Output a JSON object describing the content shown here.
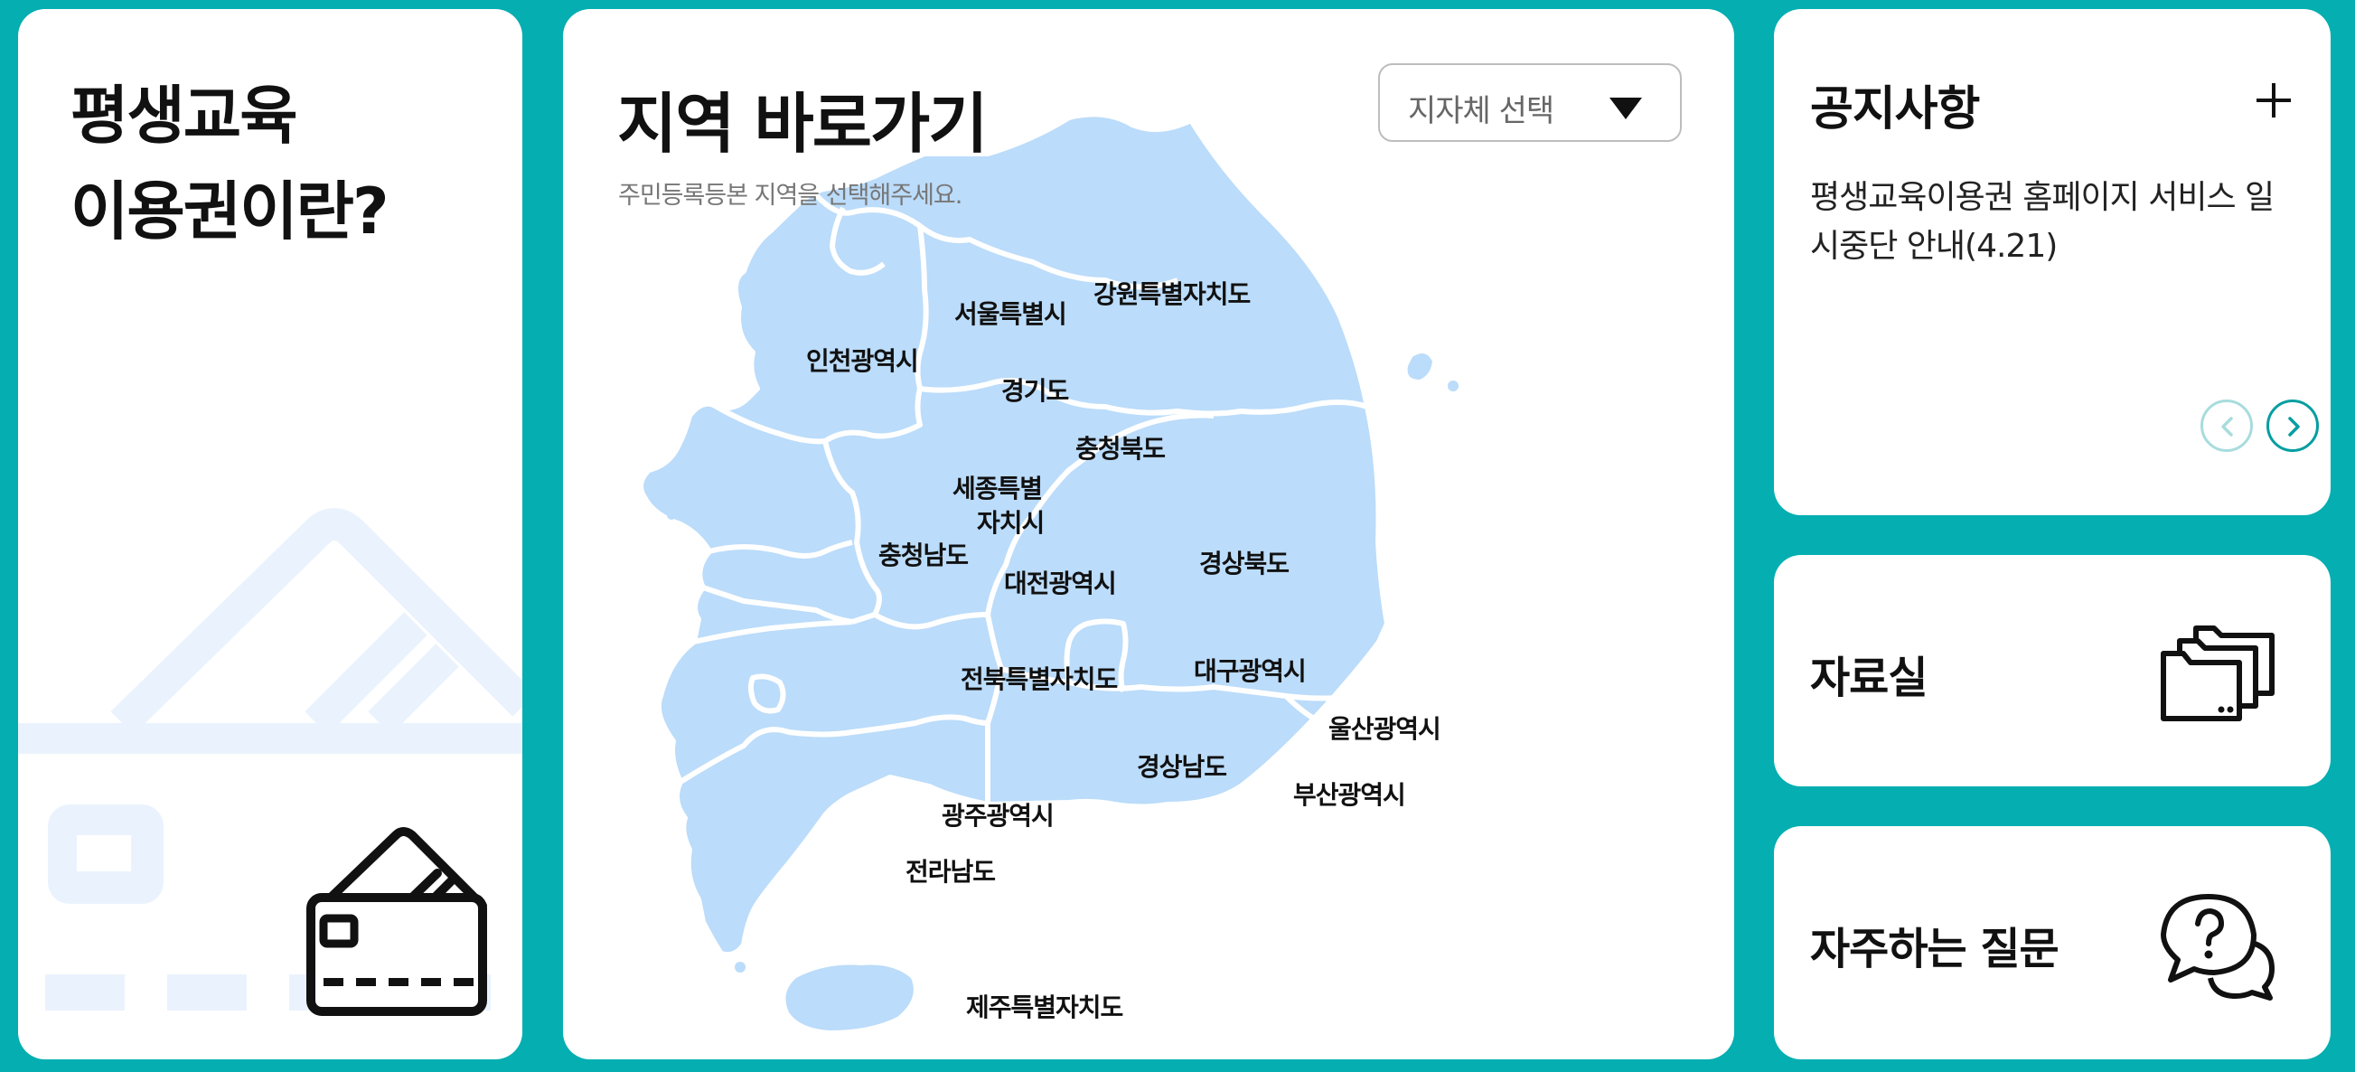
{
  "voucher_panel": {
    "title_line1": "평생교육",
    "title_line2": "이용권이란?",
    "icon": "credit-card-icon"
  },
  "region_map": {
    "title": "지역 바로가기",
    "subtitle": "주민등록등본 지역을 선택해주세요.",
    "select_label": "지자체 선택",
    "regions": {
      "seoul": "서울특별시",
      "gangwon": "강원특별자치도",
      "incheon": "인천광역시",
      "gyeonggi": "경기도",
      "chungbuk": "충청북도",
      "sejong_line1": "세종특별",
      "sejong_line2": "자치시",
      "chungnam": "충청남도",
      "daejeon": "대전광역시",
      "gyeongbuk": "경상북도",
      "jeonbuk": "전북특별자치도",
      "daegu": "대구광역시",
      "ulsan": "울산광역시",
      "gyeongnam": "경상남도",
      "busan": "부산광역시",
      "gwangju": "광주광역시",
      "jeonnam": "전라남도",
      "jeju": "제주특별자치도"
    },
    "map_color": "#bbdcfa"
  },
  "notice": {
    "title": "공지사항",
    "item": "평생교육이용권 홈페이지 서비스 일시중단 안내(4.21)"
  },
  "data_room": {
    "label": "자료실",
    "icon": "folders-icon"
  },
  "faq": {
    "label": "자주하는 질문",
    "icon": "question-chat-icon"
  },
  "colors": {
    "background": "#04aeb1",
    "accent": "#069ea1"
  }
}
